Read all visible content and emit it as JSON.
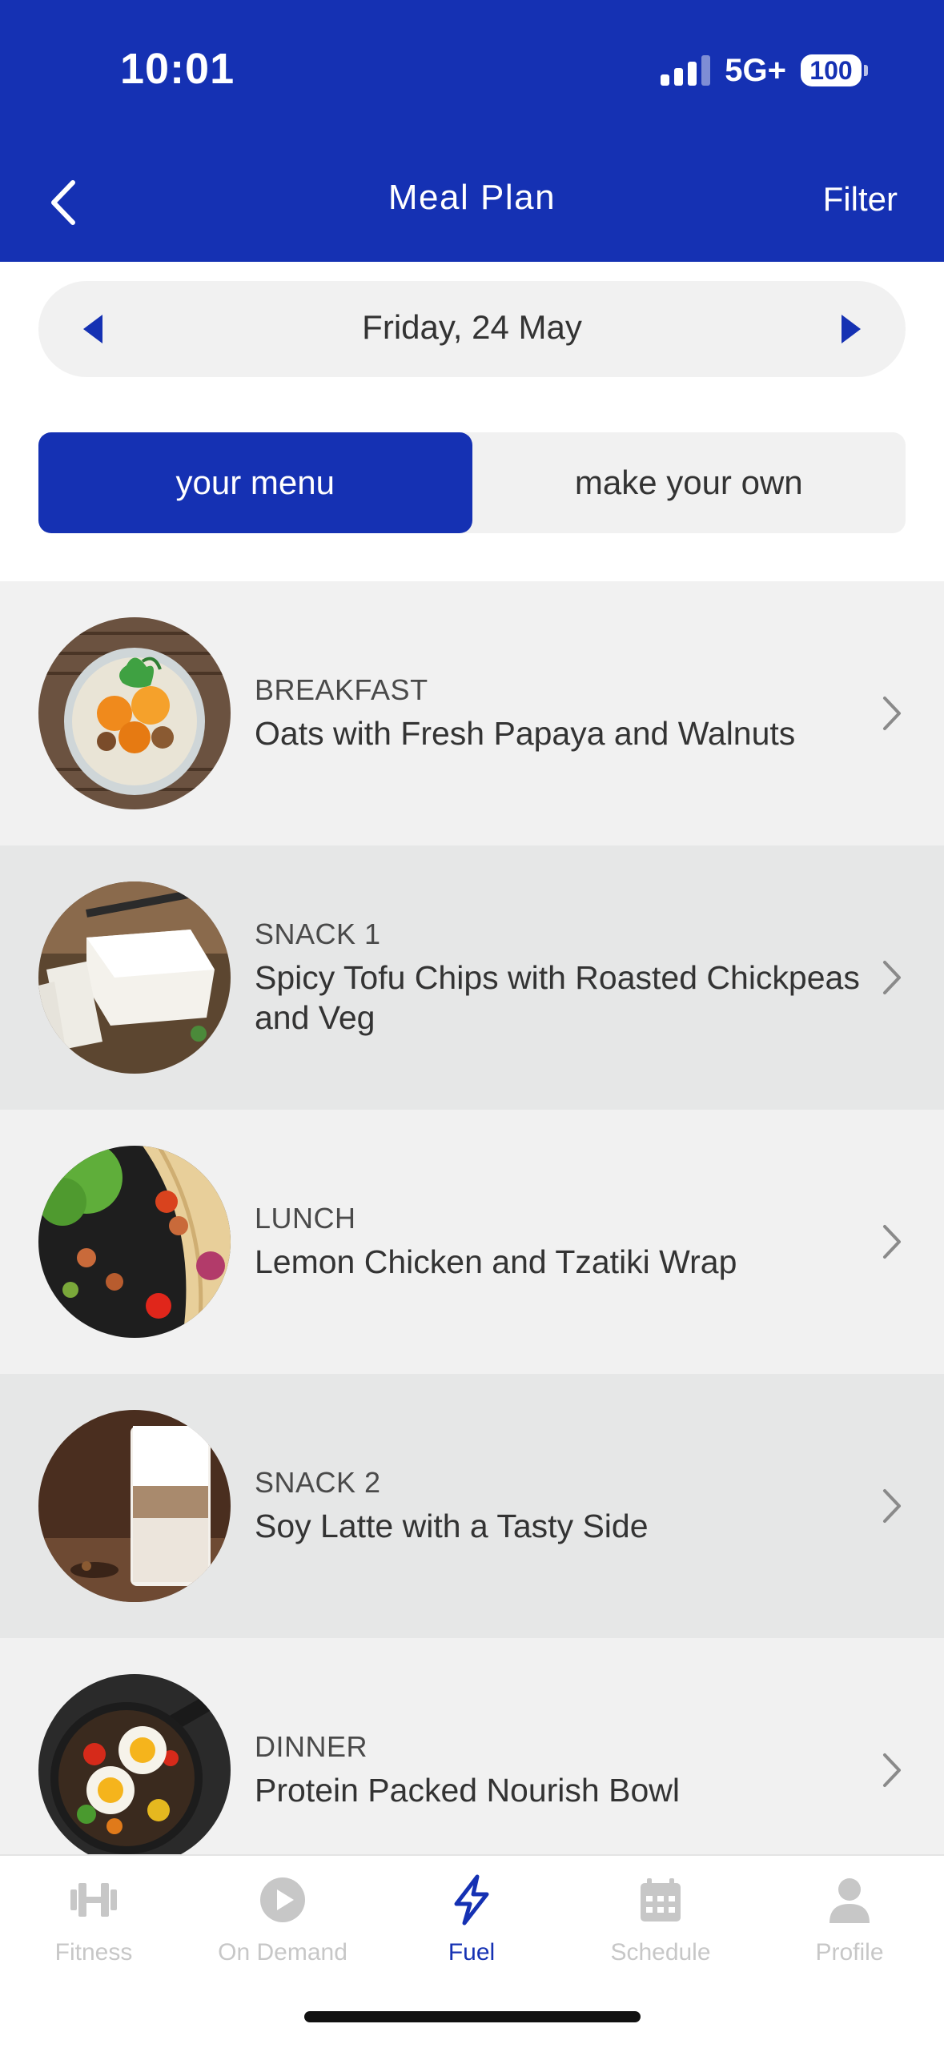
{
  "status_bar": {
    "time": "10:01",
    "network": "5G+",
    "battery": "100"
  },
  "header": {
    "title": "Meal Plan",
    "filter_label": "Filter",
    "back_icon": "chevron-left-icon",
    "background": "#1531b3"
  },
  "date_selector": {
    "date": "Friday, 24 May",
    "prev_icon": "triangle-left-icon",
    "next_icon": "triangle-right-icon"
  },
  "segment": {
    "active_label": "your menu",
    "inactive_label": "make your own"
  },
  "meals": [
    {
      "type": "BREAKFAST",
      "name": "Oats with Fresh Papaya and Walnuts",
      "image": "papaya-oats-jar"
    },
    {
      "type": "SNACK 1",
      "name": "Spicy Tofu Chips with Roasted Chickpeas and Veg",
      "image": "tofu-block"
    },
    {
      "type": "LUNCH",
      "name": "Lemon Chicken and Tzatiki Wrap",
      "image": "chicken-wrap"
    },
    {
      "type": "SNACK 2",
      "name": "Soy Latte with a Tasty Side",
      "image": "latte-glass"
    },
    {
      "type": "DINNER",
      "name": "Protein Packed Nourish Bowl",
      "image": "egg-skillet"
    }
  ],
  "tabbar": {
    "items": [
      {
        "label": "Fitness",
        "icon": "dumbbell-icon"
      },
      {
        "label": "On Demand",
        "icon": "play-circle-icon"
      },
      {
        "label": "Fuel",
        "icon": "lightning-icon",
        "active": true
      },
      {
        "label": "Schedule",
        "icon": "calendar-icon"
      },
      {
        "label": "Profile",
        "icon": "person-icon"
      }
    ],
    "active_color": "#1531b3",
    "inactive_color": "#c7c7c7"
  }
}
